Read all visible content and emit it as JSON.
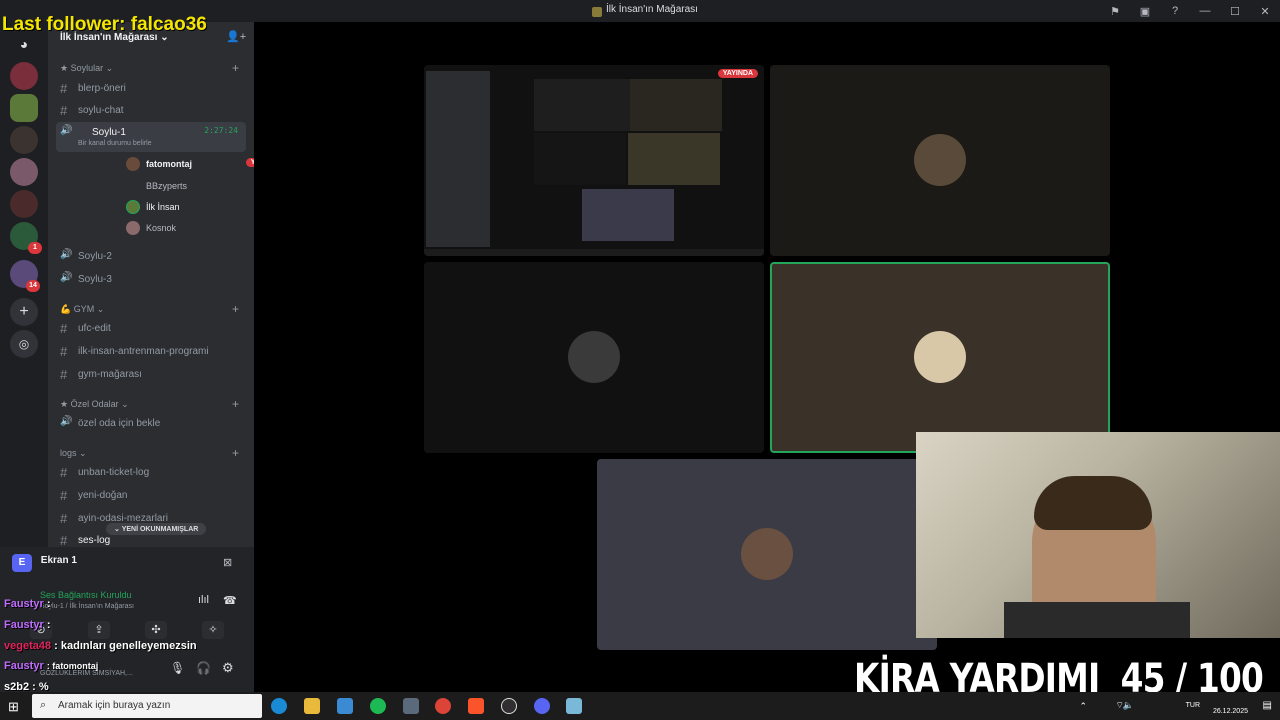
{
  "overlay": {
    "last_follower": "Last follower: falcao36",
    "kira_label": "KİRA YARDIMI",
    "kira_progress": "45 / 100",
    "kira_progress_value": 45,
    "kira_progress_max": 100
  },
  "window": {
    "title": "İlk İnsan'ın Mağarası"
  },
  "rail": {
    "badges": [
      "1",
      "14"
    ]
  },
  "server": {
    "name": "İlk İnsan'ın Mağarası"
  },
  "categories": {
    "soylular": "Soylular",
    "gym": "GYM",
    "ozel": "Özel Odalar",
    "logs": "logs"
  },
  "channels": {
    "blerp": "blerp-öneri",
    "soylu_chat": "soylu-chat",
    "soylu1": "Soylu-1",
    "soylu1_time": "2:27:24",
    "soylu1_status": "Bir kanal durumu belirle",
    "soylu2": "Soylu-2",
    "soylu3": "Soylu-3",
    "ufc": "ufc-edit",
    "antrenman": "ilk-insan-antrenman-programi",
    "gym_magarasi": "gym-mağarası",
    "ozel_oda": "özel oda için bekle",
    "unban": "unban-ticket-log",
    "yeni_dogan": "yeni-doğan",
    "ayin": "ayin-odasi-mezarlari",
    "ses_log": "ses-log"
  },
  "voice_users": [
    {
      "name": "fatomontaj",
      "live": "YAYINDA"
    },
    {
      "name": "BBzyperts"
    },
    {
      "name": "İlk İnsan"
    },
    {
      "name": "Kosnok"
    }
  ],
  "new_unread": "YENİ OKUNMAMIŞLAR",
  "panel": {
    "screen_share": "Ekran 1",
    "voice_connected": "Ses Bağlantısı Kuruldu",
    "voice_sub": "Soylu-1 / İlk İnsan'ın Mağarası"
  },
  "chat_lines": [
    {
      "user": "Faustyr",
      "text": ":"
    },
    {
      "user": "Faustyr",
      "text": ":"
    },
    {
      "user": "vegeta48",
      "text": ": kadınları genelleyemezsin"
    },
    {
      "user": "Faustyr",
      "text": ": fatomontaj"
    },
    {
      "user": "s2b2",
      "text": ": %"
    }
  ],
  "user_status": "GÖZLÜKLERİM SİMSİYAH,...",
  "stage": {
    "live_tag": "YAYINDA"
  },
  "taskbar": {
    "search_placeholder": "Aramak için buraya yazın",
    "lang": "TUR",
    "date": "26.12.2025"
  },
  "colors": {
    "accent": "#5865f2",
    "live": "#da373c",
    "speaking": "#23a55a",
    "follower": "#f5e600"
  }
}
